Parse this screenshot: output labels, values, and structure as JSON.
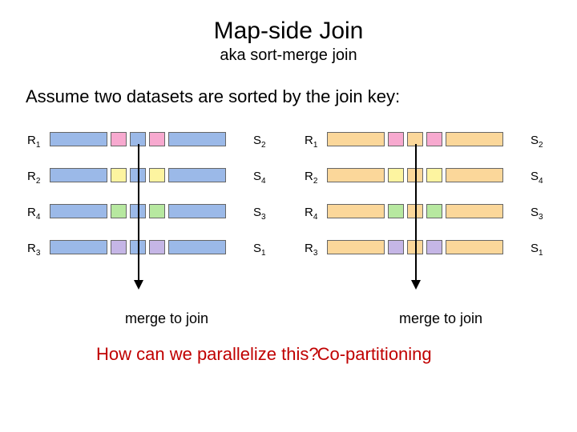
{
  "title": "Map-side Join",
  "subtitle": "aka sort-merge join",
  "assume": "Assume two datasets are sorted by the join key:",
  "rows": {
    "r1": {
      "r": "R",
      "rn": "1",
      "s": "S",
      "sn": "2"
    },
    "r2": {
      "r": "R",
      "rn": "2",
      "s": "S",
      "sn": "4"
    },
    "r3": {
      "r": "R",
      "rn": "4",
      "s": "S",
      "sn": "3"
    },
    "r4": {
      "r": "R",
      "rn": "3",
      "s": "S",
      "sn": "1"
    }
  },
  "mergeLabel": "merge to join",
  "question": "How can we parallelize this?",
  "answer": "Co-partitioning",
  "colors": {
    "blue": "#9bb9e8",
    "pink": "#f7a9cf",
    "yellow": "#fdf4a0",
    "green": "#b7e8a0",
    "purple": "#c5b6e6",
    "orange": "#fbd79a"
  }
}
